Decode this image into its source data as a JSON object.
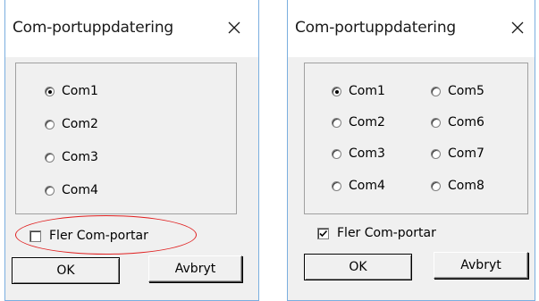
{
  "dialogs": [
    {
      "title": "Com-portuppdatering",
      "radios": [
        {
          "label": "Com1",
          "checked": true
        },
        {
          "label": "Com2",
          "checked": false
        },
        {
          "label": "Com3",
          "checked": false
        },
        {
          "label": "Com4",
          "checked": false
        }
      ],
      "more_ports": {
        "label": "Fler Com-portar",
        "checked": false
      },
      "ok_label": "OK",
      "cancel_label": "Avbryt"
    },
    {
      "title": "Com-portuppdatering",
      "radios": [
        {
          "label": "Com1",
          "checked": true
        },
        {
          "label": "Com2",
          "checked": false
        },
        {
          "label": "Com3",
          "checked": false
        },
        {
          "label": "Com4",
          "checked": false
        },
        {
          "label": "Com5",
          "checked": false
        },
        {
          "label": "Com6",
          "checked": false
        },
        {
          "label": "Com7",
          "checked": false
        },
        {
          "label": "Com8",
          "checked": false
        }
      ],
      "more_ports": {
        "label": "Fler Com-portar",
        "checked": true
      },
      "ok_label": "OK",
      "cancel_label": "Avbryt"
    }
  ],
  "colors": {
    "window_border": "#7aaedf",
    "dialog_background": "#f0f0f0",
    "highlight_ring": "#e02020"
  },
  "icons": {
    "close": "close-icon",
    "checkmark": "checkmark-icon"
  }
}
